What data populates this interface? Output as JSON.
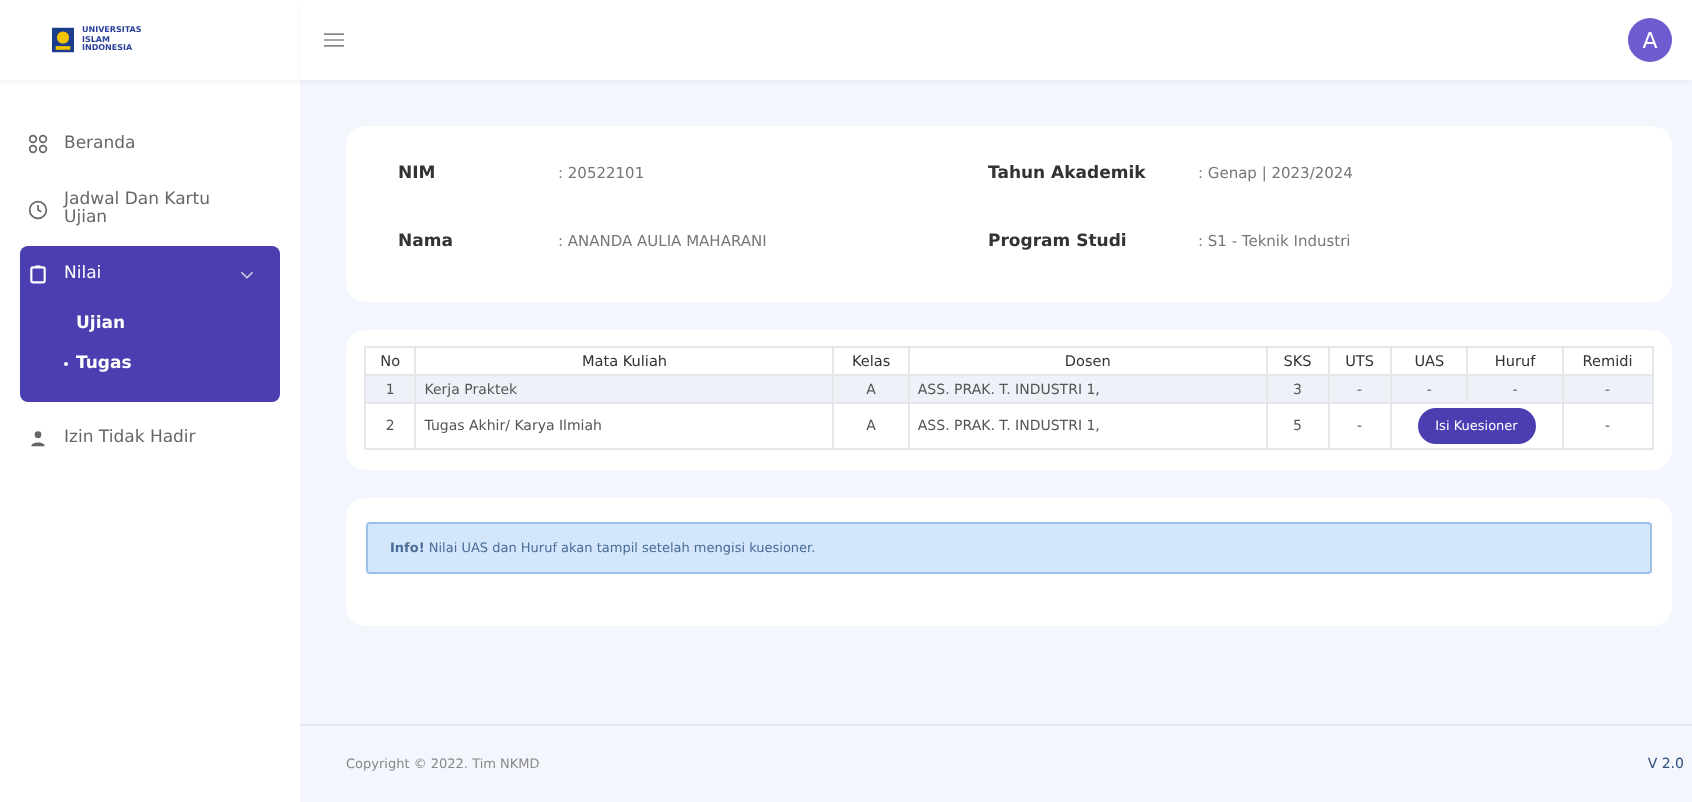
{
  "logo": {
    "text": [
      "UNIVERSITAS",
      "ISLAM",
      "INDONESIA"
    ]
  },
  "header": {
    "avatar": "A"
  },
  "sidebar": {
    "items": [
      {
        "label": "Beranda",
        "selected": false
      },
      {
        "label": "Jadwal Dan Kartu Ujian",
        "selected": false
      },
      {
        "label": "Nilai",
        "selected": true,
        "expanded": true,
        "children": [
          {
            "label": "Ujian",
            "selected": false
          },
          {
            "label": "Tugas",
            "selected": true
          }
        ]
      },
      {
        "label": "Izin Tidak Hadir",
        "selected": false
      }
    ]
  },
  "profile": [
    {
      "label": "NIM",
      "value": ": 20522101"
    },
    {
      "label": "Tahun Akademik",
      "value": ": Genap | 2023/2024"
    },
    {
      "label": "Nama",
      "value": ": ANANDA AULIA MAHARANI"
    },
    {
      "label": "Program Studi",
      "value": ": S1 - Teknik Industri"
    }
  ],
  "table": {
    "columns": [
      "No",
      "Mata Kuliah",
      "Kelas",
      "Dosen",
      "SKS",
      "UTS",
      "UAS",
      "Huruf",
      "Remidi"
    ],
    "rows": [
      {
        "no": "1",
        "mata_kuliah": "Kerja Praktek",
        "kelas": "A",
        "dosen": "ASS. PRAK. T. INDUSTRI 1,",
        "sks": "3",
        "uts": "-",
        "uas": "-",
        "huruf": "-",
        "remidi": "-"
      },
      {
        "no": "2",
        "mata_kuliah": "Tugas Akhir/ Karya Ilmiah",
        "kelas": "A",
        "dosen": "ASS. PRAK. T. INDUSTRI 1,",
        "sks": "5",
        "uts": "-",
        "action": "Isi Kuesioner",
        "remidi": "-"
      }
    ]
  },
  "alert": {
    "text": "**Info!** Nilai UAS dan Huruf akan tampil setelah mengisi kuesioner."
  },
  "footer": {
    "copyright": "Copyright © 2022. Tim NKMD",
    "version": "V 2.0"
  }
}
